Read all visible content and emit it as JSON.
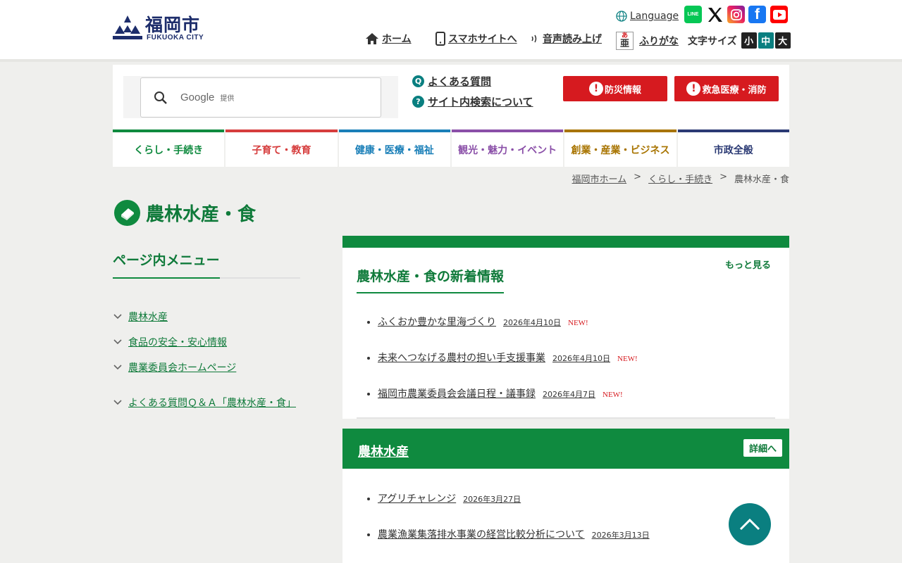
{
  "header": {
    "logo_title": "福岡市",
    "logo_sub": "FUKUOKA CITY",
    "language": "Language",
    "social": {
      "line": "LINE",
      "fb": "f"
    },
    "util_nav": [
      "ホーム",
      "スマホサイトへ",
      "音声読み上げ",
      "ふりがな"
    ],
    "furigana_badge_top": "あ",
    "furigana_badge_bottom": "亜",
    "font_size_label": "文字サイズ",
    "font_sizes": [
      "小",
      "中",
      "大"
    ],
    "font_size_active": "中"
  },
  "search": {
    "google": "Google",
    "provided": "提供",
    "faq": "よくある質問",
    "about_search": "サイト内検索について",
    "q_icon": "Q",
    "help_icon": "?"
  },
  "alerts": [
    "防災情報",
    "救急医療・消防"
  ],
  "global_nav": [
    {
      "label": "くらし・手続き",
      "color": "#0f8a3f"
    },
    {
      "label": "子育て・教育",
      "color": "#d63d3d"
    },
    {
      "label": "健康・医療・福祉",
      "color": "#1a7fb8"
    },
    {
      "label": "観光・魅力・イベント",
      "color": "#8a4fa8"
    },
    {
      "label": "創業・産業・ビジネス",
      "color": "#a87400"
    },
    {
      "label": "市政全般",
      "color": "#2b3a74"
    }
  ],
  "breadcrumb": [
    "福岡市ホーム",
    "くらし・手続き",
    "農林水産・食"
  ],
  "breadcrumb_sep": ">",
  "page_title": "農林水産・食",
  "side_menu": {
    "title": "ページ内メニュー",
    "items": [
      "農林水産",
      "食品の安全・安心情報",
      "農業委員会ホームページ",
      "よくある質問Ｑ＆Ａ「農林水産・食」"
    ]
  },
  "news": {
    "title": "農林水産・食の新着情報",
    "more": "もっと見る",
    "new_label": "NEW!",
    "items": [
      {
        "title": "ふくおか豊かな里海づくり",
        "date": "2026年4月10日"
      },
      {
        "title": "未来へつなげる農村の担い手支援事業",
        "date": "2026年4月10日"
      },
      {
        "title": "福岡市農業委員会会議日程・議事録",
        "date": "2026年4月7日"
      }
    ]
  },
  "section": {
    "title": "農林水産",
    "detail": "詳細へ",
    "items": [
      {
        "title": "アグリチャレンジ",
        "date": "2026年3月27日"
      },
      {
        "title": "農業漁業集落排水事業の経営比較分析について",
        "date": "2026年3月13日"
      }
    ]
  },
  "colors": {
    "brand_green": "#0f8a3f",
    "teal": "#0a7f80",
    "alert_red": "#d61a1f",
    "navy": "#1d2d6b"
  }
}
